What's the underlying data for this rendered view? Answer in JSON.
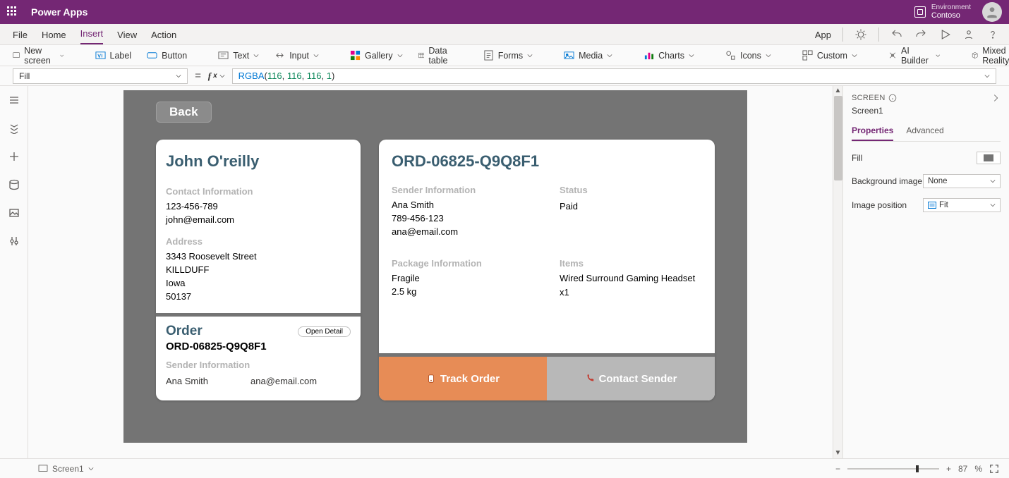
{
  "titlebar": {
    "app": "Power Apps",
    "env_label": "Environment",
    "env_name": "Contoso"
  },
  "menu": {
    "items": [
      "File",
      "Home",
      "Insert",
      "View",
      "Action"
    ],
    "active": 2,
    "app_label": "App"
  },
  "ribbon": {
    "new_screen": "New screen",
    "label": "Label",
    "button": "Button",
    "text": "Text",
    "input": "Input",
    "gallery": "Gallery",
    "data_table": "Data table",
    "forms": "Forms",
    "media": "Media",
    "charts": "Charts",
    "icons": "Icons",
    "custom": "Custom",
    "ai": "AI Builder",
    "mr": "Mixed Reality"
  },
  "formula": {
    "prop": "Fill",
    "value_prefix": "RGBA",
    "n1": "116",
    "n2": "116",
    "n3": "116",
    "n4": "1"
  },
  "canvas": {
    "back": "Back",
    "customer": {
      "name": "John O'reilly",
      "contact_hdr": "Contact Information",
      "phone": "123-456-789",
      "email": "john@email.com",
      "address_hdr": "Address",
      "addr1": "3343  Roosevelt Street",
      "addr2": "KILLDUFF",
      "addr3": "Iowa",
      "addr4": "50137",
      "order_hdr": "Order",
      "open_detail": "Open Detail",
      "order_no": "ORD-06825-Q9Q8F1",
      "sender_hdr": "Sender Information",
      "sender_name": "Ana Smith",
      "sender_email": "ana@email.com"
    },
    "order": {
      "title": "ORD-06825-Q9Q8F1",
      "sender_hdr": "Sender Information",
      "sender_name": "Ana Smith",
      "sender_phone": "789-456-123",
      "sender_email": "ana@email.com",
      "status_hdr": "Status",
      "status": "Paid",
      "pkg_hdr": "Package Information",
      "pkg1": "Fragile",
      "pkg2": "2.5 kg",
      "items_hdr": "Items",
      "item1": "Wired Surround Gaming Headset",
      "item2": "x1",
      "track": "Track Order",
      "contact": "Contact Sender"
    }
  },
  "rightpane": {
    "header": "SCREEN",
    "name": "Screen1",
    "tabs": [
      "Properties",
      "Advanced"
    ],
    "fill": "Fill",
    "bg": "Background image",
    "bg_val": "None",
    "imgpos": "Image position",
    "imgpos_val": "Fit"
  },
  "status": {
    "screen": "Screen1",
    "zoom": "87",
    "pct": "%"
  }
}
